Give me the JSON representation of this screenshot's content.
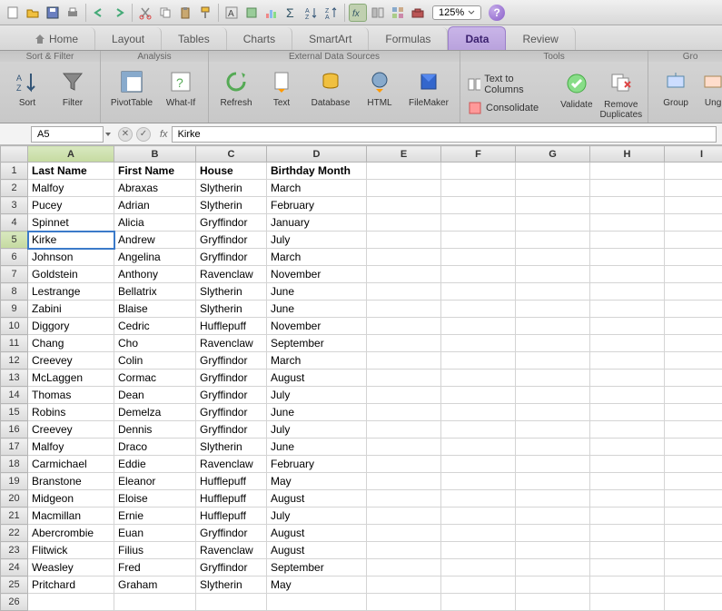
{
  "zoom": "125%",
  "tabs": {
    "home": "Home",
    "layout": "Layout",
    "tables": "Tables",
    "charts": "Charts",
    "smartart": "SmartArt",
    "formulas": "Formulas",
    "data": "Data",
    "review": "Review"
  },
  "ribbon": {
    "groups": {
      "sort_filter": "Sort & Filter",
      "analysis": "Analysis",
      "external": "External Data Sources",
      "tools": "Tools",
      "group": "Gro"
    },
    "buttons": {
      "sort": "Sort",
      "filter": "Filter",
      "pivot": "PivotTable",
      "whatif": "What-If",
      "refresh": "Refresh",
      "text": "Text",
      "database": "Database",
      "html": "HTML",
      "filemaker": "FileMaker",
      "text_to_columns": "Text to Columns",
      "consolidate": "Consolidate",
      "validate": "Validate",
      "remove_dup": "Remove\nDuplicates",
      "group_btn": "Group",
      "ungroup": "Ung"
    }
  },
  "formula": {
    "name_box": "A5",
    "fx": "fx",
    "value": "Kirke"
  },
  "columns": [
    "A",
    "B",
    "C",
    "D",
    "E",
    "F",
    "G",
    "H",
    "I"
  ],
  "headers": [
    "Last Name",
    "First Name",
    "House",
    "Birthday Month"
  ],
  "selected_cell": {
    "row": 5,
    "col": 0
  },
  "rows": [
    [
      "Malfoy",
      "Abraxas",
      "Slytherin",
      "March"
    ],
    [
      "Pucey",
      "Adrian",
      "Slytherin",
      "February"
    ],
    [
      "Spinnet",
      "Alicia",
      "Gryffindor",
      "January"
    ],
    [
      "Kirke",
      "Andrew",
      "Gryffindor",
      "July"
    ],
    [
      "Johnson",
      "Angelina",
      "Gryffindor",
      "March"
    ],
    [
      "Goldstein",
      "Anthony",
      "Ravenclaw",
      "November"
    ],
    [
      "Lestrange",
      "Bellatrix",
      "Slytherin",
      "June"
    ],
    [
      "Zabini",
      "Blaise",
      "Slytherin",
      "June"
    ],
    [
      "Diggory",
      "Cedric",
      "Hufflepuff",
      "November"
    ],
    [
      "Chang",
      "Cho",
      "Ravenclaw",
      "September"
    ],
    [
      "Creevey",
      "Colin",
      "Gryffindor",
      "March"
    ],
    [
      "McLaggen",
      "Cormac",
      "Gryffindor",
      "August"
    ],
    [
      "Thomas",
      "Dean",
      "Gryffindor",
      "July"
    ],
    [
      "Robins",
      "Demelza",
      "Gryffindor",
      "June"
    ],
    [
      "Creevey",
      "Dennis",
      "Gryffindor",
      "July"
    ],
    [
      "Malfoy",
      "Draco",
      "Slytherin",
      "June"
    ],
    [
      "Carmichael",
      "Eddie",
      "Ravenclaw",
      "February"
    ],
    [
      "Branstone",
      "Eleanor",
      "Hufflepuff",
      "May"
    ],
    [
      "Midgeon",
      "Eloise",
      "Hufflepuff",
      "August"
    ],
    [
      "Macmillan",
      "Ernie",
      "Hufflepuff",
      "July"
    ],
    [
      "Abercrombie",
      "Euan",
      "Gryffindor",
      "August"
    ],
    [
      "Flitwick",
      "Filius",
      "Ravenclaw",
      "August"
    ],
    [
      "Weasley",
      "Fred",
      "Gryffindor",
      "September"
    ],
    [
      "Pritchard",
      "Graham",
      "Slytherin",
      "May"
    ]
  ]
}
